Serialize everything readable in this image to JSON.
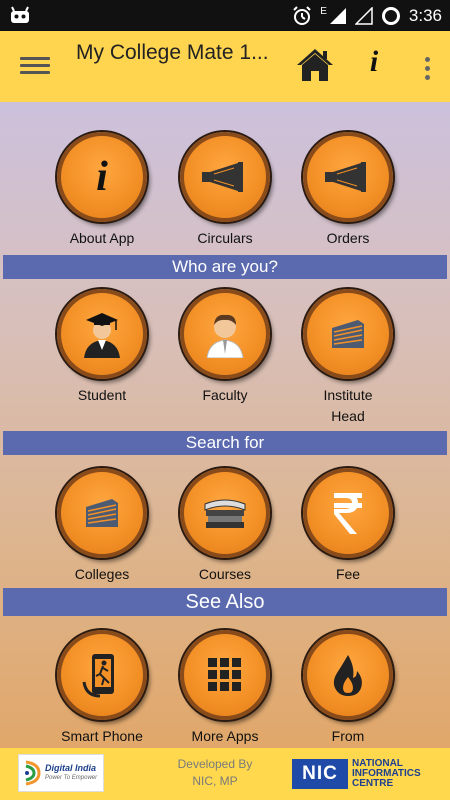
{
  "status_bar": {
    "time": "3:36",
    "network_label": "E"
  },
  "app_bar": {
    "title": "My College Mate 1...",
    "info_label": "i"
  },
  "sections": {
    "who": "Who are you?",
    "search": "Search for",
    "see_also": "See Also"
  },
  "tiles": {
    "about_app": "About App",
    "circulars": "Circulars",
    "orders": "Orders",
    "student": "Student",
    "faculty": "Faculty",
    "institute_head": "Institute\nHead",
    "colleges": "Colleges",
    "courses": "Courses",
    "fee": "Fee",
    "smart_phone": "Smart Phone",
    "more_apps": "More Apps",
    "from": "From"
  },
  "footer": {
    "digital_india": "Digital India",
    "digital_india_tagline": "Power To Empower",
    "developed_by": "Developed By",
    "developer": "NIC, MP",
    "nic_short": "NIC",
    "nic_line1": "NATIONAL",
    "nic_line2": "INFORMATICS",
    "nic_line3": "CENTRE"
  },
  "colors": {
    "app_bar": "#ffd54f",
    "section_header": "#5b6aae",
    "tile_orange": "#f39127",
    "footer": "#ffd84d"
  }
}
